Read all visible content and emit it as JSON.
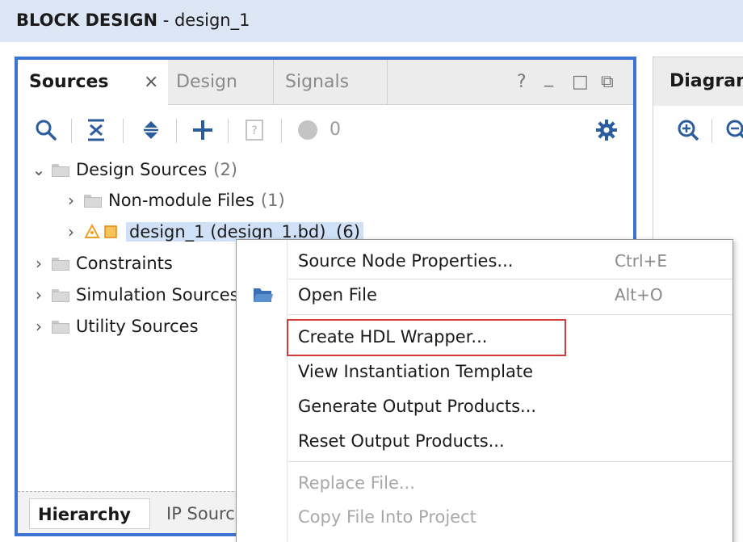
{
  "window": {
    "title_bold": "BLOCK DESIGN",
    "title_rest": " - design_1"
  },
  "sources_panel": {
    "tabs": {
      "sources": "Sources",
      "close": "×",
      "design": "Design",
      "signals": "Signals"
    },
    "window_controls": {
      "help": "?",
      "minimize": "_",
      "maximize": "□",
      "float": "⧉"
    },
    "toolbar": {
      "icons": [
        "search-icon",
        "collapse-all-icon",
        "expand-all-icon",
        "add-icon",
        "help-doc-icon",
        "status-dot-icon",
        "gear-icon"
      ],
      "status_count": "0"
    },
    "tree": [
      {
        "label": "Design Sources",
        "count": "(2)"
      },
      {
        "label": "Non-module Files",
        "count": "(1)"
      },
      {
        "label": "design_1 (design_1.bd)",
        "count": "(6)"
      },
      {
        "label": "Constraints",
        "count": ""
      },
      {
        "label": "Simulation Sources",
        "count": ""
      },
      {
        "label": "Utility Sources",
        "count": ""
      }
    ],
    "bottom_tabs": {
      "hierarchy": "Hierarchy",
      "ip_sources": "IP Sources"
    }
  },
  "diagram_panel": {
    "title": "Diagram",
    "icons": [
      "zoom-in-icon",
      "zoom-out-icon"
    ]
  },
  "context_menu": {
    "items": [
      {
        "label": "Source Node Properties...",
        "shortcut": "Ctrl+E"
      },
      {
        "label": "Open File",
        "shortcut": "Alt+O"
      },
      {
        "label": "Create HDL Wrapper...",
        "shortcut": ""
      },
      {
        "label": "View Instantiation Template",
        "shortcut": ""
      },
      {
        "label": "Generate Output Products...",
        "shortcut": ""
      },
      {
        "label": "Reset Output Products...",
        "shortcut": ""
      },
      {
        "label": "Replace File...",
        "shortcut": ""
      },
      {
        "label": "Copy File Into Project",
        "shortcut": ""
      }
    ],
    "highlight_color": "#d43b3b"
  },
  "colors": {
    "title_bar": "#dde6f4",
    "panel_border_active": "#3d73d1",
    "selection": "#cfe0f7"
  }
}
